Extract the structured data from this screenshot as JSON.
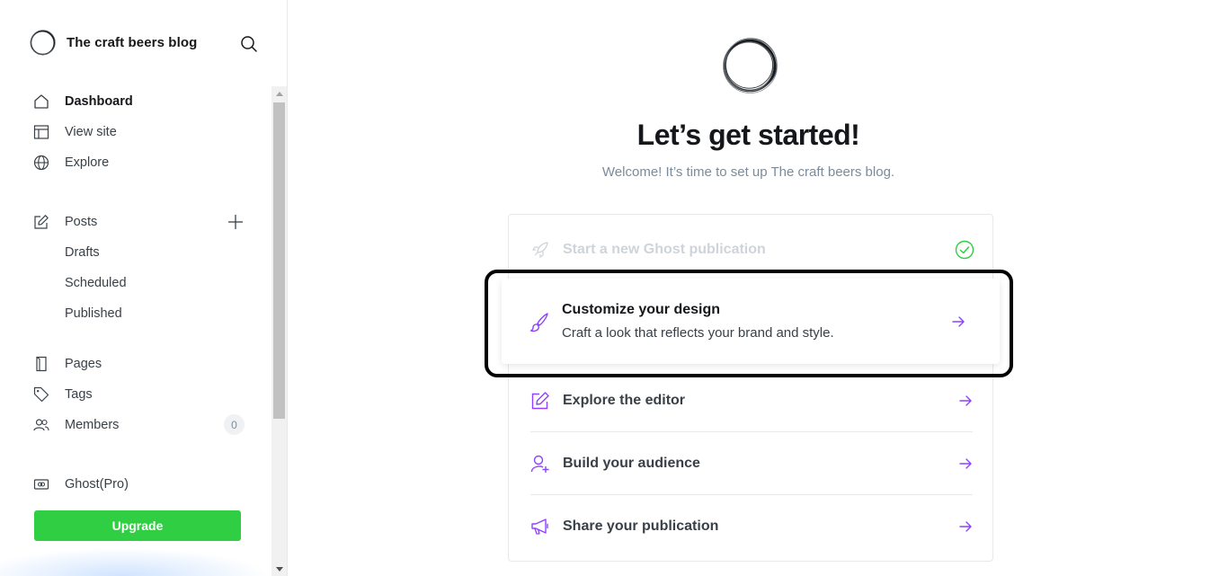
{
  "sidebar": {
    "brand_title": "The craft beers blog",
    "items": [
      {
        "label": "Dashboard",
        "icon": "home-icon"
      },
      {
        "label": "View site",
        "icon": "layout-icon"
      },
      {
        "label": "Explore",
        "icon": "globe-icon"
      },
      {
        "label": "Posts",
        "icon": "edit-icon"
      },
      {
        "label": "Pages",
        "icon": "page-icon"
      },
      {
        "label": "Tags",
        "icon": "tag-icon"
      },
      {
        "label": "Members",
        "icon": "members-icon"
      },
      {
        "label": "Ghost(Pro)",
        "icon": "ghost-pro-icon"
      }
    ],
    "post_subitems": [
      "Drafts",
      "Scheduled",
      "Published"
    ],
    "members_count": "0",
    "upgrade_label": "Upgrade"
  },
  "main": {
    "title": "Let’s get started!",
    "subtitle": "Welcome! It’s time to set up The craft beers blog.",
    "steps": [
      {
        "title": "Start a new Ghost publication",
        "status": "done"
      },
      {
        "title": "Customize your design",
        "description": "Craft a look that reflects your brand and style."
      },
      {
        "title": "Explore the editor"
      },
      {
        "title": "Build your audience"
      },
      {
        "title": "Share your publication"
      }
    ]
  },
  "colors": {
    "accent": "#8e42ff",
    "success": "#30cf43",
    "text": "#15171a",
    "muted": "#7c8b9a"
  }
}
